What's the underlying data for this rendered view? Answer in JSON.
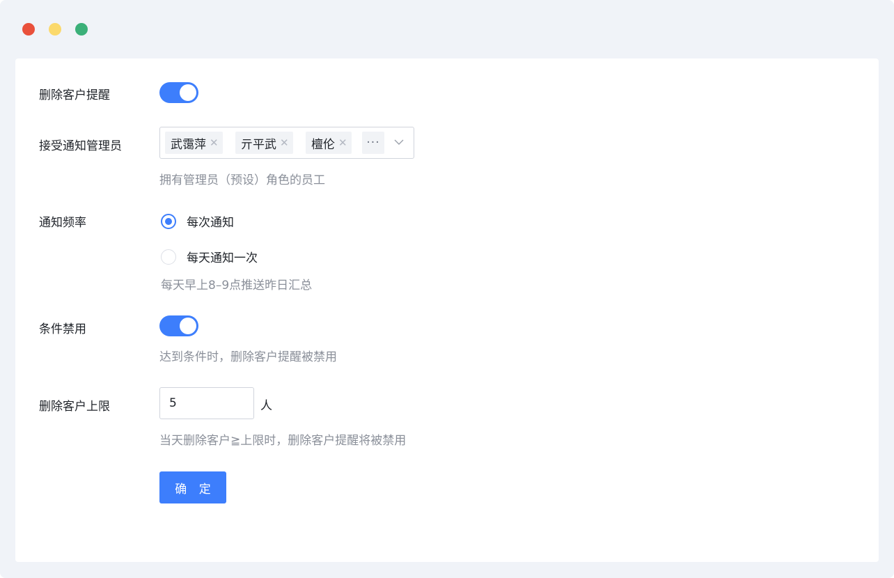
{
  "window": {
    "controls": [
      "close",
      "minimize",
      "maximize"
    ],
    "colors": {
      "close": "#e9503b",
      "minimize": "#fbd96c",
      "maximize": "#3bb079"
    }
  },
  "form": {
    "delete_reminder": {
      "label": "删除客户提醒",
      "enabled": true
    },
    "notify_admins": {
      "label": "接受通知管理员",
      "tags": [
        "武霭萍",
        "亓平武",
        "檀伦"
      ],
      "more": "···",
      "hint": "拥有管理员（预设）角色的员工"
    },
    "frequency": {
      "label": "通知频率",
      "options": [
        {
          "label": "每次通知",
          "checked": true
        },
        {
          "label": "每天通知一次",
          "checked": false
        }
      ],
      "hint": "每天早上8–9点推送昨日汇总"
    },
    "condition_disable": {
      "label": "条件禁用",
      "enabled": true,
      "hint": "达到条件时，删除客户提醒被禁用"
    },
    "limit": {
      "label": "删除客户上限",
      "value": "5",
      "unit": "人",
      "hint": "当天删除客户≧上限时，删除客户提醒将被禁用"
    },
    "submit_label": "确 定"
  },
  "colors": {
    "primary": "#3d7efc",
    "hint_text": "#8a8f99",
    "background": "#f0f3f8"
  }
}
